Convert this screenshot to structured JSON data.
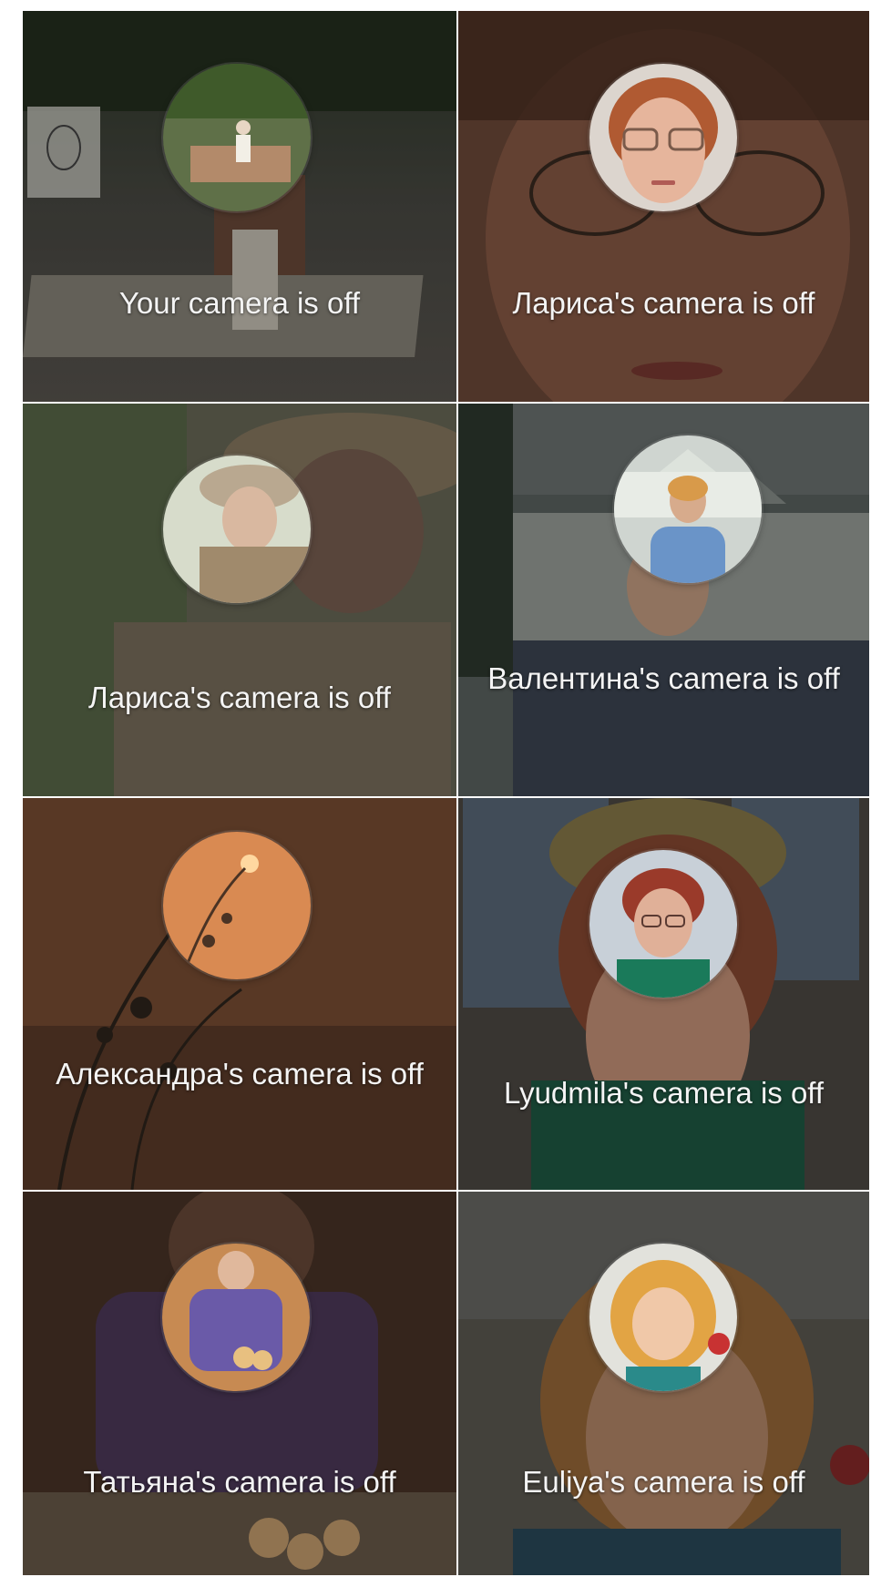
{
  "participants": [
    {
      "name": "You",
      "label": "Your camera is off",
      "camera": "off"
    },
    {
      "name": "Лариса",
      "label": "Лариса's camera is off",
      "camera": "off"
    },
    {
      "name": "Лариса",
      "label": "Лариса's camera is off",
      "camera": "off"
    },
    {
      "name": "Валентина",
      "label": "Валентина's camera is off",
      "camera": "off"
    },
    {
      "name": "Александра",
      "label": "Александра's camera is off",
      "camera": "off"
    },
    {
      "name": "Lyudmila",
      "label": "Lyudmila's camera is off",
      "camera": "off"
    },
    {
      "name": "Татьяна",
      "label": "Татьяна's camera is off",
      "camera": "off"
    },
    {
      "name": "Euliya",
      "label": "Euliya's camera is off",
      "camera": "off"
    }
  ],
  "theme": {
    "label_color": "#f4f4f4"
  }
}
